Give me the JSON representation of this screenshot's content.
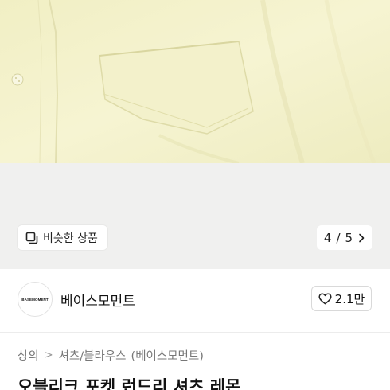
{
  "gallery": {
    "similar_label": "비슷한 상품",
    "current_page": "4",
    "page_separator": "/",
    "total_pages": "5",
    "icons": {
      "similar": "similar-products-icon",
      "next": "chevron-right-icon"
    }
  },
  "brand": {
    "logo_text": "BASEMOMENT",
    "name": "베이스모먼트",
    "likes": "2.1만",
    "icons": {
      "like": "heart-outline-icon"
    }
  },
  "breadcrumb": {
    "category": "상의",
    "separator": ">",
    "subcategory": "셔츠/블라우스",
    "brand_tag": "(베이스모먼트)"
  },
  "product": {
    "title": "오블리크 포켓 런드리 셔츠 레몬"
  },
  "colors": {
    "shirt": "#f4f2c9",
    "background": "#ffffff",
    "gallery_bg": "#f0f0ef"
  }
}
